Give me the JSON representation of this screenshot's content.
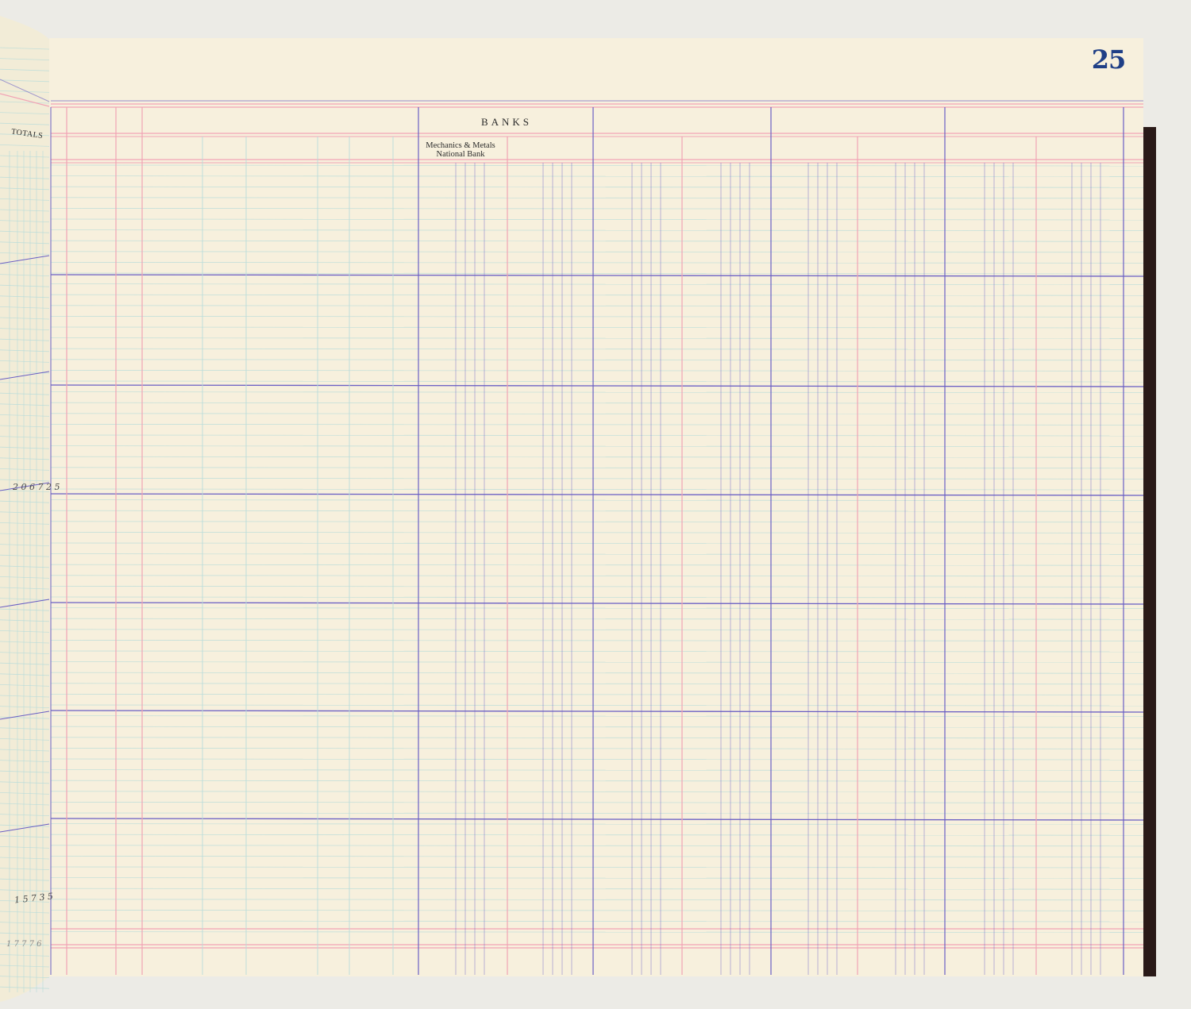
{
  "page": {
    "number": "25",
    "header_group": "BANKS",
    "bank_column": "Mechanics & Metals\nNational Bank",
    "left_page_header": "TOTALS",
    "left_page_entries": [
      "2 0 6 7 2 5",
      "1 5 7 3 5",
      "1 7 7 7 6"
    ]
  },
  "colors": {
    "paper": "#f7f0dd",
    "red_rule": "#f1a3b5",
    "blue_rule": "#6a5fc4",
    "fine_rule": "#b8dcd9",
    "page_number": "#1f3f86"
  }
}
